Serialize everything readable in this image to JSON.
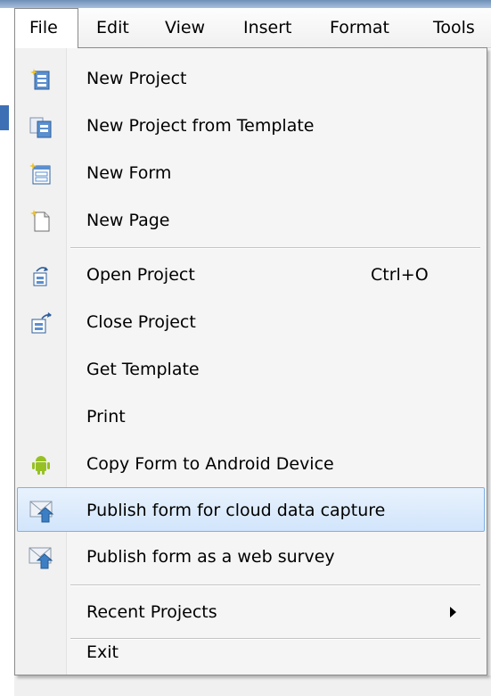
{
  "menubar": {
    "items": [
      {
        "label": "File",
        "active": true
      },
      {
        "label": "Edit"
      },
      {
        "label": "View"
      },
      {
        "label": "Insert"
      },
      {
        "label": "Format"
      },
      {
        "label": "Tools"
      }
    ]
  },
  "file_menu": {
    "items": [
      {
        "label": "New Project",
        "icon": "new-project-icon"
      },
      {
        "label": "New Project from Template",
        "icon": "new-project-from-template-icon"
      },
      {
        "label": "New Form",
        "icon": "new-form-icon"
      },
      {
        "label": "New Page",
        "icon": "new-page-icon"
      },
      {
        "label": "Open Project",
        "shortcut": "Ctrl+O",
        "icon": "open-project-icon"
      },
      {
        "label": "Close Project",
        "icon": "close-project-icon"
      },
      {
        "label": "Get Template"
      },
      {
        "label": "Print"
      },
      {
        "label": "Copy Form to Android Device",
        "icon": "android-icon"
      },
      {
        "label": "Publish form for cloud data capture",
        "icon": "publish-cloud-icon",
        "highlighted": true
      },
      {
        "label": "Publish form as a web survey",
        "icon": "publish-web-icon"
      },
      {
        "label": "Recent Projects",
        "submenu": true
      },
      {
        "label": "Exit"
      }
    ]
  },
  "colors": {
    "highlight_fill": "#dbe9fb",
    "highlight_border": "#7eb0e6",
    "android_green": "#97c024",
    "icon_blue": "#3d7fc4"
  }
}
